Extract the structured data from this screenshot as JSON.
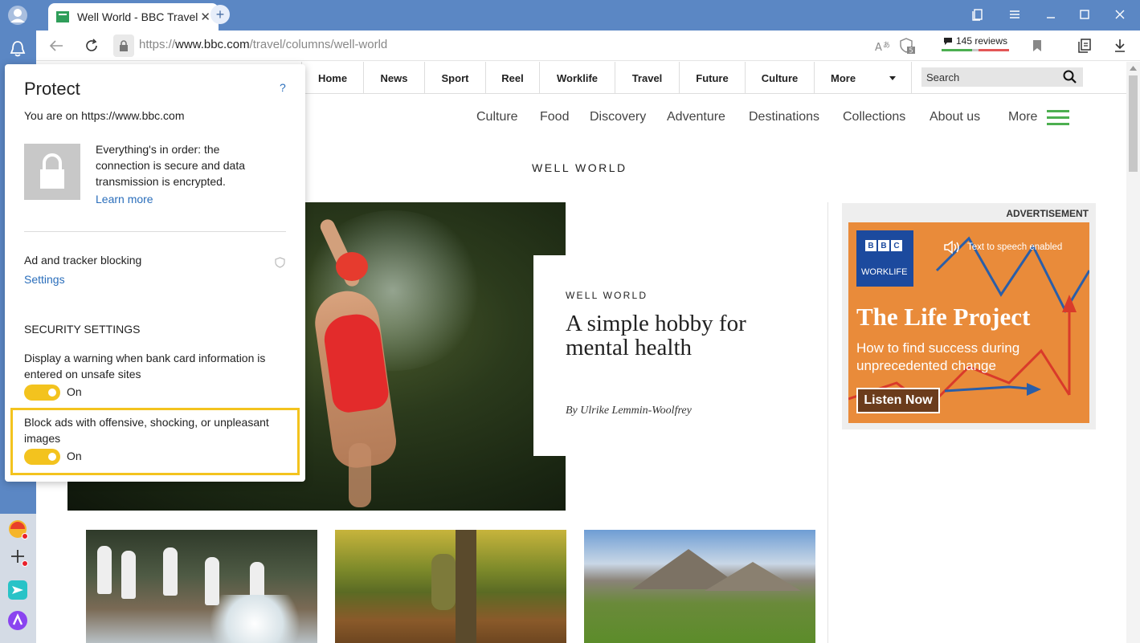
{
  "browser": {
    "tab_title": "Well World - BBC Travel",
    "tab_close": "✕",
    "new_tab": "+",
    "url_scheme": "https://",
    "url_host": "www.bbc.com",
    "url_path": "/travel/columns/well-world",
    "reviews": "145 reviews",
    "tracker_count": "5"
  },
  "bbc_nav": {
    "items": [
      "Home",
      "News",
      "Sport",
      "Reel",
      "Worklife",
      "Travel",
      "Future",
      "Culture",
      "More"
    ],
    "search_placeholder": "Search"
  },
  "travel_nav": {
    "items": [
      "Culture",
      "Food",
      "Discovery",
      "Adventure",
      "Destinations",
      "Collections",
      "About us"
    ],
    "more": "More"
  },
  "section_title": "WELL WORLD",
  "article": {
    "kicker": "WELL WORLD",
    "title": "A simple hobby for mental health",
    "byline": "By Ulrike Lemmin-Woolfrey"
  },
  "ad": {
    "label": "ADVERTISEMENT",
    "logo_letters": [
      "B",
      "B",
      "C"
    ],
    "logo_sub": "WORKLIFE",
    "tts": "Text to speech enabled",
    "title": "The Life Project",
    "subtitle": "How to find success during unprecedented change",
    "button": "Listen Now"
  },
  "protect": {
    "title": "Protect",
    "help": "?",
    "site": "You are on https://www.bbc.com",
    "status": "Everything's in order: the connection is secure and data transmission is encrypted.",
    "learn_more": "Learn more",
    "ad_tracker": "Ad and tracker blocking",
    "settings": "Settings",
    "security_heading": "SECURITY SETTINGS",
    "bank_warning": "Display a warning when bank card information is entered on unsafe sites",
    "bank_warning_state": "On",
    "block_ads": "Block ads with offensive, shocking, or unpleasant images",
    "block_ads_state": "On"
  },
  "colors": {
    "accent": "#f3c31e",
    "frame": "#5b87c4",
    "link": "#2a6ebb",
    "travel_green": "#4caf50",
    "ad_orange": "#e98b3a",
    "bbc_blue": "#1c4a9e"
  }
}
